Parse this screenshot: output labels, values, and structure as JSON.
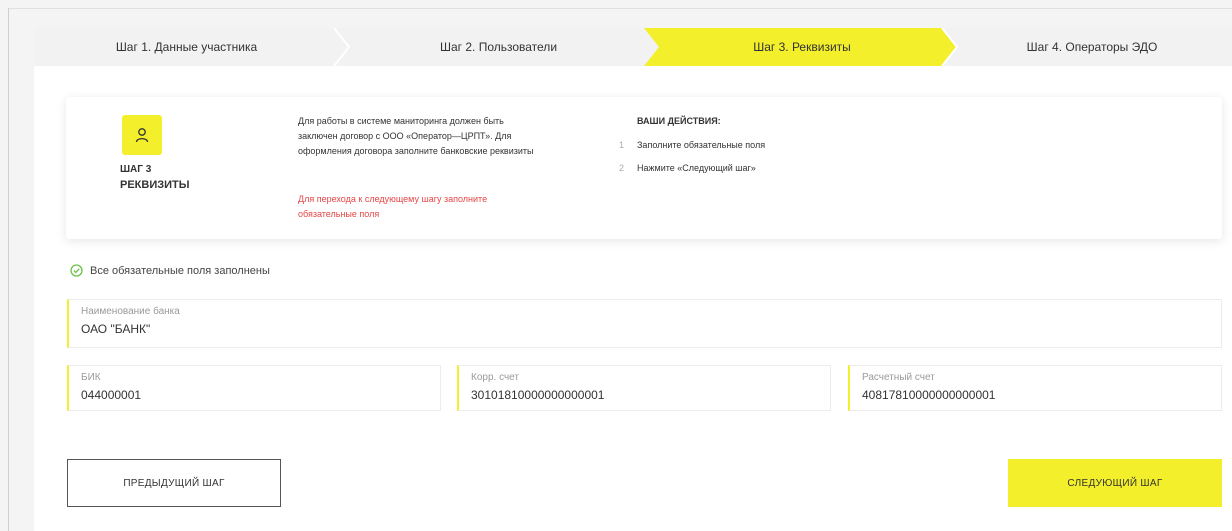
{
  "colors": {
    "accent": "#f3ef2b",
    "warning": "#e64646",
    "success": "#6cc24a"
  },
  "stepper": {
    "steps": [
      {
        "label": "Шаг 1. Данные участника",
        "active": false
      },
      {
        "label": "Шаг 2. Пользователи",
        "active": false
      },
      {
        "label": "Шаг 3. Реквизиты",
        "active": true
      },
      {
        "label": "Шаг 4. Операторы ЭДО",
        "active": false
      }
    ]
  },
  "info": {
    "icon": "user-icon",
    "step_number": "ШАГ 3",
    "step_name": "РЕКВИЗИТЫ",
    "description": "Для работы в системе маниторинга должен быть заключен договор с ООО «Оператор—ЦРПТ». Для оформления договора заполните банковские реквизиты",
    "warning": "Для перехода к следующему шагу заполните обязательные поля",
    "actions_title": "ВАШИ ДЕЙСТВИЯ:",
    "actions": [
      {
        "num": "1",
        "text": "Заполните обязательные поля"
      },
      {
        "num": "2",
        "text": "Нажмите «Следующий шаг»"
      }
    ]
  },
  "status": {
    "icon": "check-circle-icon",
    "text": "Все обязательные поля заполнены"
  },
  "form": {
    "bank_name": {
      "label": "Наименование банка",
      "value": "ОАО \"БАНК\""
    },
    "bik": {
      "label": "БИК",
      "value": "044000001"
    },
    "corr_account": {
      "label": "Корр. счет",
      "value": "30101810000000000001"
    },
    "settlement_account": {
      "label": "Расчетный счет",
      "value": "40817810000000000001"
    }
  },
  "buttons": {
    "prev": "ПРЕДЫДУЩИЙ ШАГ",
    "next": "СЛЕДУЮЩИЙ ШАГ"
  }
}
